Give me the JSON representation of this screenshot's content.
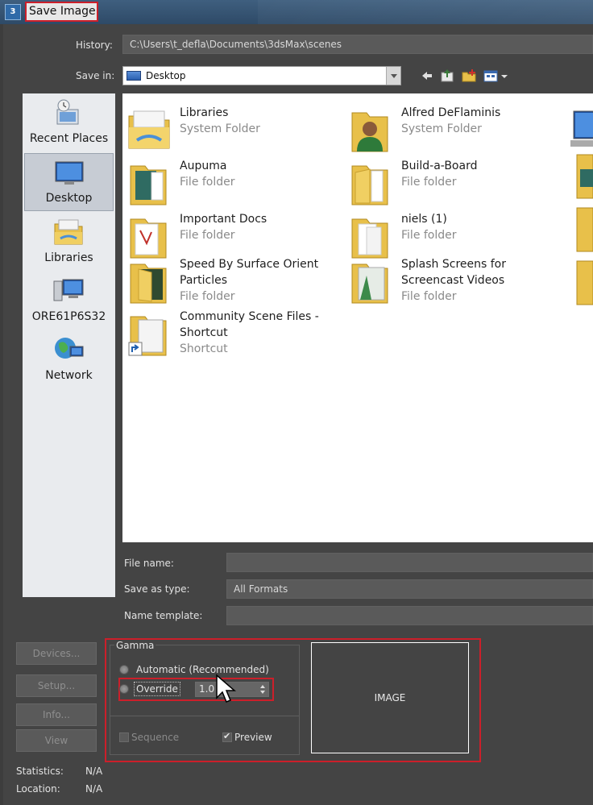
{
  "window": {
    "title": "Save Image",
    "app_icon_text": "3"
  },
  "toolbar": {
    "history_label": "History:",
    "history_value": "C:\\Users\\t_defla\\Documents\\3dsMax\\scenes",
    "savein_label": "Save in:",
    "savein_value": "Desktop",
    "icons": [
      "back-arrow-icon",
      "up-one-level-icon",
      "new-folder-icon",
      "view-menu-icon"
    ]
  },
  "places": [
    {
      "label": "Recent Places",
      "icon": "recent-places-icon"
    },
    {
      "label": "Desktop",
      "icon": "desktop-icon",
      "selected": true
    },
    {
      "label": "Libraries",
      "icon": "libraries-icon"
    },
    {
      "label": "ORE61P6S32",
      "icon": "computer-icon"
    },
    {
      "label": "Network",
      "icon": "network-icon"
    }
  ],
  "files": [
    {
      "name": "Libraries",
      "type": "System Folder"
    },
    {
      "name": "Alfred DeFlaminis",
      "type": "System Folder"
    },
    {
      "name": "Aupuma",
      "type": "File folder"
    },
    {
      "name": "Build-a-Board",
      "type": "File folder"
    },
    {
      "name": "Important Docs",
      "type": "File folder"
    },
    {
      "name": "niels (1)",
      "type": "File folder"
    },
    {
      "name": "Speed By Surface Orient Particles",
      "type": "File folder"
    },
    {
      "name": "Splash Screens for Screencast Videos",
      "type": "File folder"
    },
    {
      "name": "Community Scene Files - Shortcut",
      "type": "Shortcut"
    }
  ],
  "form": {
    "filename_label": "File name:",
    "filename_value": "",
    "savetype_label": "Save as type:",
    "savetype_value": "All Formats",
    "template_label": "Name template:",
    "template_value": ""
  },
  "buttons": {
    "devices": "Devices...",
    "setup": "Setup...",
    "info": "Info...",
    "view": "View"
  },
  "gamma": {
    "group_label": "Gamma",
    "automatic_label": "Automatic (Recommended)",
    "override_label": "Override",
    "override_value": "1.0"
  },
  "options": {
    "sequence_label": "Sequence",
    "preview_label": "Preview",
    "preview_checked": true
  },
  "preview_image_label": "IMAGE",
  "info": {
    "statistics_label": "Statistics:",
    "statistics_value": "N/A",
    "location_label": "Location:",
    "location_value": "N/A"
  },
  "colors": {
    "highlight_outline": "#cc1f2a",
    "dialog_bg": "#444444",
    "file_area_bg": "#ffffff"
  }
}
